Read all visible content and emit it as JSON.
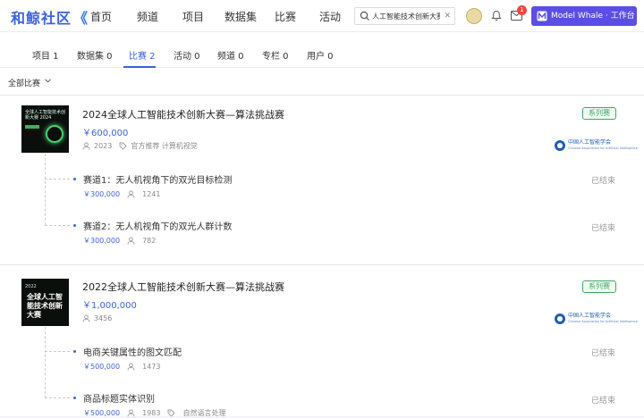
{
  "brand": {
    "logo_text": "和鲸社区",
    "logo_mark": "《"
  },
  "nav": [
    "首页",
    "频道",
    "项目",
    "数据集",
    "比赛",
    "活动"
  ],
  "search": {
    "value": "人工智能技术创新大赛",
    "clear": "✕"
  },
  "notifications": {
    "count": "1"
  },
  "model_whale": {
    "label": "Model Whale · 工作台"
  },
  "tabs": [
    {
      "label": "项目 1"
    },
    {
      "label": "数据集 0"
    },
    {
      "label": "比赛 2",
      "active": true
    },
    {
      "label": "活动 0"
    },
    {
      "label": "频道 0"
    },
    {
      "label": "专栏 0"
    },
    {
      "label": "用户 0"
    }
  ],
  "filter": {
    "label": "全部比赛"
  },
  "competitions": [
    {
      "title": "2024全球人工智能技术创新大赛—算法挑战赛",
      "prize": "￥600,000",
      "participants": "2023",
      "tags": "官方推荐  计算机视觉",
      "badge": "系列赛",
      "thumb_text": "全球人工智能技术创新大赛 2024",
      "org": {
        "cn": "中国人工智能学会",
        "en": "Chinese Association for Artificial Intelligence"
      },
      "tracks": [
        {
          "title": "赛道1：无人机视角下的双光目标检测",
          "prize": "￥300,000",
          "participants": "1241",
          "status": "已结束"
        },
        {
          "title": "赛道2：无人机视角下的双光人群计数",
          "prize": "￥300,000",
          "participants": "782",
          "status": "已结束"
        }
      ]
    },
    {
      "title": "2022全球人工智能技术创新大赛—算法挑战赛",
      "prize": "￥1,000,000",
      "participants": "3456",
      "badge": "系列赛",
      "thumb_top": "2022",
      "thumb_big": "全球人工智能技术创新大赛",
      "org": {
        "cn": "中国人工智能学会",
        "en": "Chinese Association for Artificial Intelligence"
      },
      "tracks": [
        {
          "title": "电商关键属性的图文匹配",
          "prize": "￥500,000",
          "participants": "1473",
          "status": "已结束"
        },
        {
          "title": "商品标题实体识别",
          "prize": "￥500,000",
          "participants": "1983",
          "tags": "自然语言处理",
          "status": "已结束"
        }
      ]
    }
  ]
}
